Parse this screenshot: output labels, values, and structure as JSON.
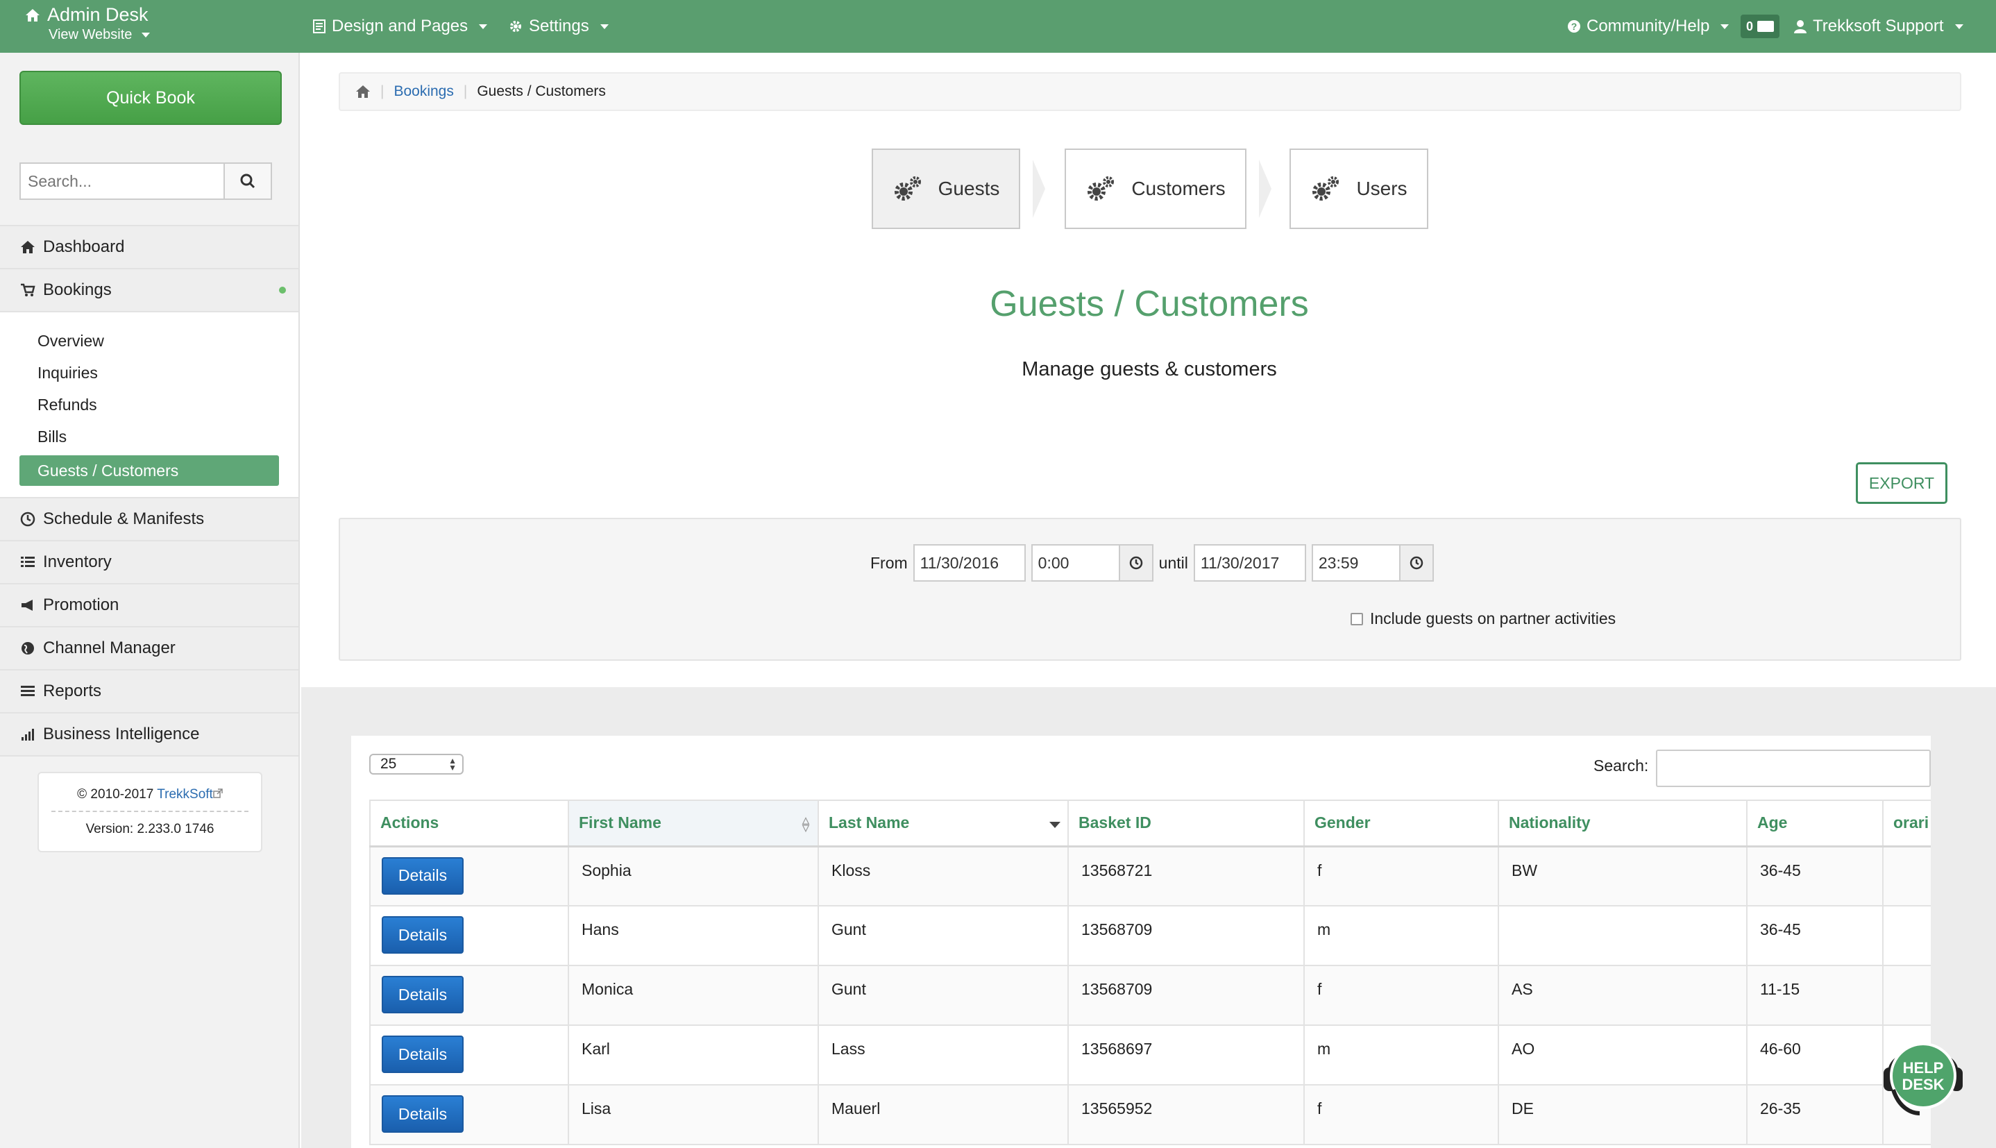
{
  "topbar": {
    "brand": "Admin Desk",
    "view_website": "View Website",
    "design_pages": "Design and Pages",
    "settings": "Settings",
    "community_help": "Community/Help",
    "mail_count": "0",
    "user": "Trekksoft Support"
  },
  "sidebar": {
    "quick_book": "Quick Book",
    "search_placeholder": "Search...",
    "menu": {
      "dashboard": "Dashboard",
      "bookings": "Bookings",
      "schedule": "Schedule & Manifests",
      "inventory": "Inventory",
      "promotion": "Promotion",
      "channel_manager": "Channel Manager",
      "reports": "Reports",
      "business_intelligence": "Business Intelligence"
    },
    "bookings_sub": [
      "Overview",
      "Inquiries",
      "Refunds",
      "Bills",
      "Guests / Customers"
    ],
    "copyright": "© 2010-2017",
    "copyright_link": "TrekkSoft",
    "version": "Version: 2.233.0 1746"
  },
  "breadcrumb": {
    "parent": "Bookings",
    "current": "Guests / Customers"
  },
  "steps": [
    "Guests",
    "Customers",
    "Users"
  ],
  "main": {
    "title": "Guests / Customers",
    "subtitle": "Manage guests & customers",
    "export": "EXPORT"
  },
  "filter": {
    "from_label": "From",
    "from_date": "11/30/2016",
    "from_time": "0:00",
    "until_label": "until",
    "until_date": "11/30/2017",
    "until_time": "23:59",
    "partner_label": "Include guests on partner activities"
  },
  "table": {
    "page_size": "25",
    "search_label": "Search:",
    "columns": [
      "Actions",
      "First Name",
      "Last Name",
      "Basket ID",
      "Gender",
      "Nationality",
      "Age",
      "orari"
    ],
    "details_label": "Details",
    "rows": [
      {
        "first": "Sophia",
        "last": "Kloss",
        "basket": "13568721",
        "gender": "f",
        "nationality": "BW",
        "age": "36-45"
      },
      {
        "first": "Hans",
        "last": "Gunt",
        "basket": "13568709",
        "gender": "m",
        "nationality": "",
        "age": "36-45"
      },
      {
        "first": "Monica",
        "last": "Gunt",
        "basket": "13568709",
        "gender": "f",
        "nationality": "AS",
        "age": "11-15"
      },
      {
        "first": "Karl",
        "last": "Lass",
        "basket": "13568697",
        "gender": "m",
        "nationality": "AO",
        "age": "46-60"
      },
      {
        "first": "Lisa",
        "last": "Mauerl",
        "basket": "13565952",
        "gender": "f",
        "nationality": "DE",
        "age": "26-35"
      }
    ]
  },
  "helpdesk": {
    "line1": "HELP",
    "line2": "DESK"
  },
  "colors": {
    "brand_green": "#5a9e6f",
    "title_green": "#55a06d",
    "button_blue": "#1a5fad"
  }
}
